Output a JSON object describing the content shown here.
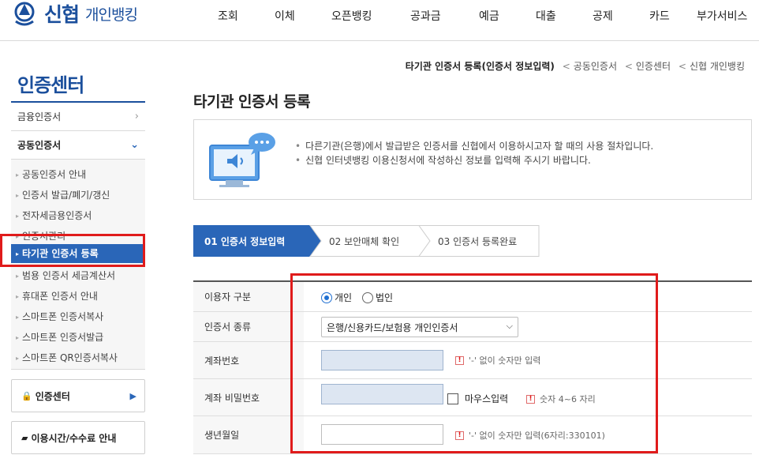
{
  "header": {
    "brand": "신협",
    "sub": "개인뱅킹",
    "menu": [
      "조회",
      "이체",
      "오픈뱅킹",
      "공과금",
      "예금",
      "대출",
      "공제",
      "카드",
      "부가서비스"
    ]
  },
  "sidebar": {
    "title": "인증센터",
    "sections": [
      "금융인증서",
      "공동인증서"
    ],
    "sub_items": [
      "공동인증서 안내",
      "인증서 발급/폐기/갱신",
      "전자세금용인증서",
      "인증서관리",
      "타기관 인증서 등록",
      "범용 인증서 세금계산서",
      "휴대폰 인증서 안내",
      "스마트폰 인증서복사",
      "스마트폰 인증서발급",
      "스마트폰 QR인증서복사"
    ],
    "buttons": [
      "인증센터",
      "이용시간/수수료 안내"
    ]
  },
  "breadcrumb": {
    "current": "타기관 인증서 등록(인증서 정보입력)",
    "trail": [
      "공동인증서",
      "인증센터",
      "신협 개인뱅킹"
    ]
  },
  "page": {
    "title": "타기관 인증서 등록",
    "info": [
      "다른기관(은행)에서 발급받은 인증서를 신협에서 이용하시고자 할 때의 사용 절차입니다.",
      "신협 인터넷뱅킹 이용신청서에 작성하신 정보를 입력해 주시기 바랍니다."
    ]
  },
  "steps": [
    "01 인증서 정보입력",
    "02 보안매체 확인",
    "03 인증서 등록완료"
  ],
  "form": {
    "user_type": {
      "label": "이용자 구분",
      "options": [
        "개인",
        "법인"
      ],
      "selected": "개인"
    },
    "cert_type": {
      "label": "인증서 종류",
      "value": "은행/신용카드/보험용 개인인증서"
    },
    "account": {
      "label": "계좌번호",
      "value": "",
      "hint": "'-' 없이 숫자만 입력"
    },
    "account_pw": {
      "label": "계좌 비밀번호",
      "value": "",
      "mouse_input": "마우스입력",
      "hint": "숫자 4~6 자리"
    },
    "birth": {
      "label": "생년월일",
      "value": "",
      "hint": "'-' 없이 숫자만 입력(6자리:330101)"
    }
  },
  "colors": {
    "brand": "#1b4f9c",
    "accent": "#2a66b8",
    "highlight": "#e01b1b"
  }
}
